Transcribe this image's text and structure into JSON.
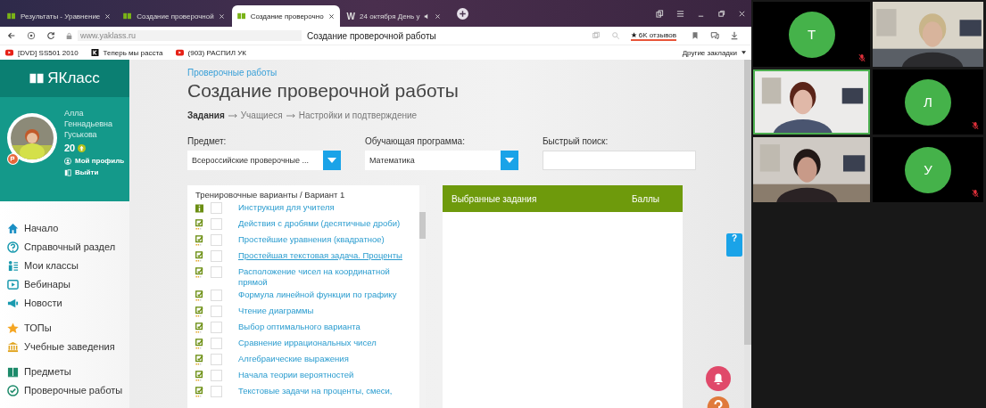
{
  "browser": {
    "tabs": [
      {
        "title": "Результаты - Уравнение",
        "kind": "site",
        "selected": false,
        "audio": false
      },
      {
        "title": "Создание проверочной",
        "kind": "site",
        "selected": false,
        "audio": false
      },
      {
        "title": "Создание проверочно",
        "kind": "site",
        "selected": true,
        "audio": false
      },
      {
        "title": "24 октября День у",
        "kind": "letter",
        "favicon": "W",
        "selected": false,
        "audio": true
      }
    ],
    "url": "www.yaklass.ru",
    "page_title": "Создание проверочной работы",
    "reviews": "6K отзывов",
    "bookmarks": [
      {
        "label": "[DVD] SS501 2010",
        "kind": "video"
      },
      {
        "label": "Теперь мы расста",
        "kind": "k"
      },
      {
        "label": "(903) РАСПИЛ УК",
        "kind": "video"
      }
    ],
    "other_bookmarks": "Другие закладки"
  },
  "sidebar": {
    "logo": "ЯКласс",
    "user": {
      "name": "Алла Геннадьевна Гуськова",
      "points": "20",
      "links": [
        "Мой профиль",
        "Выйти"
      ]
    },
    "groups": [
      {
        "items": [
          "Начало",
          "Справочный раздел",
          "Мои классы",
          "Вебинары",
          "Новости"
        ]
      },
      {
        "items": [
          "ТОПы",
          "Учебные заведения"
        ]
      },
      {
        "items": [
          "Предметы",
          "Проверочные работы"
        ]
      }
    ]
  },
  "main": {
    "breadcrumb": "Проверочные работы",
    "title": "Создание проверочной работы",
    "steps": [
      {
        "label": "Задания",
        "selected": true
      },
      {
        "label": "Учащиеся",
        "selected": false
      },
      {
        "label": "Настройки и подтверждение",
        "selected": false
      }
    ],
    "filters": [
      {
        "label": "Предмет:",
        "kind": "select",
        "value": "Всероссийские проверочные ..."
      },
      {
        "label": "Обучающая программа:",
        "kind": "select",
        "value": "Математика"
      },
      {
        "label": "Быстрый поиск:",
        "kind": "search"
      }
    ],
    "tasks": {
      "header": "Тренировочные варианты / Вариант 1",
      "items": [
        {
          "label": "Инструкция для учителя",
          "kind": "info",
          "checked": false,
          "highlighted": false
        },
        {
          "label": "Действия с дробями (десятичные дроби)",
          "kind": "task",
          "checked": false,
          "highlighted": false
        },
        {
          "label": "Простейшие уравнения (квадратное)",
          "kind": "task",
          "checked": false,
          "highlighted": false
        },
        {
          "label": "Простейшая текстовая задача. Проценты",
          "kind": "task",
          "checked": false,
          "highlighted": true
        },
        {
          "label": "Расположение чисел на координатной прямой",
          "kind": "task",
          "checked": false,
          "highlighted": false
        },
        {
          "label": "Формула линейной функции по графику",
          "kind": "task",
          "checked": false,
          "highlighted": false
        },
        {
          "label": "Чтение диаграммы",
          "kind": "task",
          "checked": false,
          "highlighted": false
        },
        {
          "label": "Выбор оптимального варианта",
          "kind": "task",
          "checked": false,
          "highlighted": false
        },
        {
          "label": "Сравнение иррациональных чисел",
          "kind": "task",
          "checked": false,
          "highlighted": false
        },
        {
          "label": "Алгебраические выражения",
          "kind": "task",
          "checked": false,
          "highlighted": false
        },
        {
          "label": "Начала теории вероятностей",
          "kind": "task",
          "checked": false,
          "highlighted": false
        },
        {
          "label": "Текстовые задачи на проценты, смеси,",
          "kind": "task",
          "checked": false,
          "highlighted": false
        }
      ]
    },
    "selected_panel": {
      "columns": [
        "Выбранные задания",
        "Баллы"
      ]
    },
    "help_tab": "?"
  },
  "video": {
    "tiles": [
      {
        "kind": "avatar",
        "initial": "Т",
        "muted": true,
        "active": false
      },
      {
        "kind": "camera",
        "muted": false,
        "active": false
      },
      {
        "kind": "camera",
        "muted": false,
        "active": true
      },
      {
        "kind": "avatar",
        "initial": "Л",
        "muted": true,
        "active": false
      },
      {
        "kind": "camera",
        "muted": false,
        "active": false
      },
      {
        "kind": "avatar",
        "initial": "У",
        "muted": true,
        "active": false
      }
    ]
  }
}
